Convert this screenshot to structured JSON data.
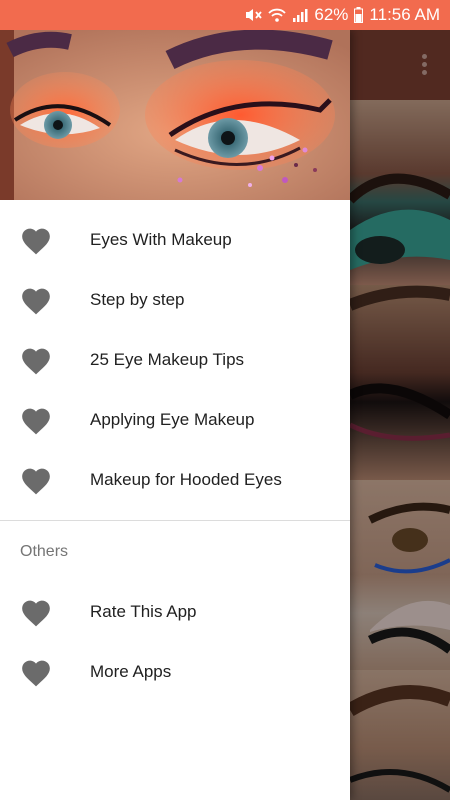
{
  "status_bar": {
    "battery": "62%",
    "time": "11:56 AM",
    "color": "#f26b4e",
    "icons": [
      "mute-icon",
      "wifi-icon",
      "signal-icon",
      "battery-icon"
    ]
  },
  "drawer": {
    "header_image": "eye makeup close-up",
    "main_items": [
      {
        "label": "Eyes With Makeup",
        "icon": "heart-icon"
      },
      {
        "label": "Step by step",
        "icon": "heart-icon"
      },
      {
        "label": "25 Eye Makeup Tips",
        "icon": "heart-icon"
      },
      {
        "label": "Applying Eye Makeup",
        "icon": "heart-icon"
      },
      {
        "label": "Makeup for Hooded Eyes",
        "icon": "heart-icon"
      }
    ],
    "section_title": "Others",
    "other_items": [
      {
        "label": "Rate This App",
        "icon": "heart-icon"
      },
      {
        "label": "More Apps",
        "icon": "heart-icon"
      }
    ],
    "icon_color": "#6b6b6b"
  },
  "background_app": {
    "toolbar_color": "#7d4032",
    "overflow_icon": "more-vert-icon"
  }
}
